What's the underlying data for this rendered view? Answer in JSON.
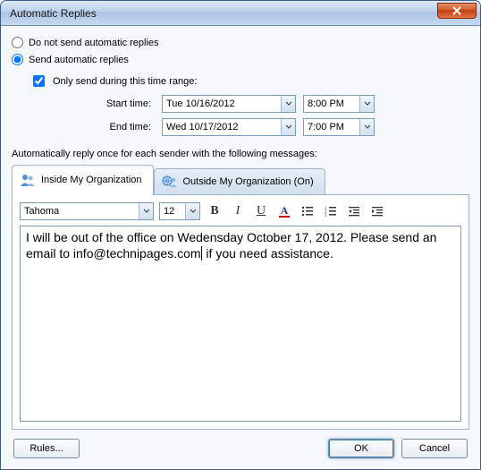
{
  "window": {
    "title": "Automatic Replies"
  },
  "radios": {
    "dont_send": "Do not send automatic replies",
    "send": "Send automatic replies"
  },
  "timerange": {
    "checkbox_label": "Only send during this time range:",
    "start_label": "Start time:",
    "end_label": "End time:",
    "start_date": "Tue 10/16/2012",
    "start_time": "8:00 PM",
    "end_date": "Wed 10/17/2012",
    "end_time": "7:00 PM"
  },
  "section_label": "Automatically reply once for each sender with the following messages:",
  "tabs": {
    "inside": "Inside My Organization",
    "outside": "Outside My Organization (On)"
  },
  "toolbar": {
    "font": "Tahoma",
    "size": "12"
  },
  "message_part1": "I will be out of the office on Wedensday October 17, 2012. Please send an email to info@technipages.com",
  "message_part2": " if you need assistance.",
  "buttons": {
    "rules": "Rules...",
    "ok": "OK",
    "cancel": "Cancel"
  }
}
